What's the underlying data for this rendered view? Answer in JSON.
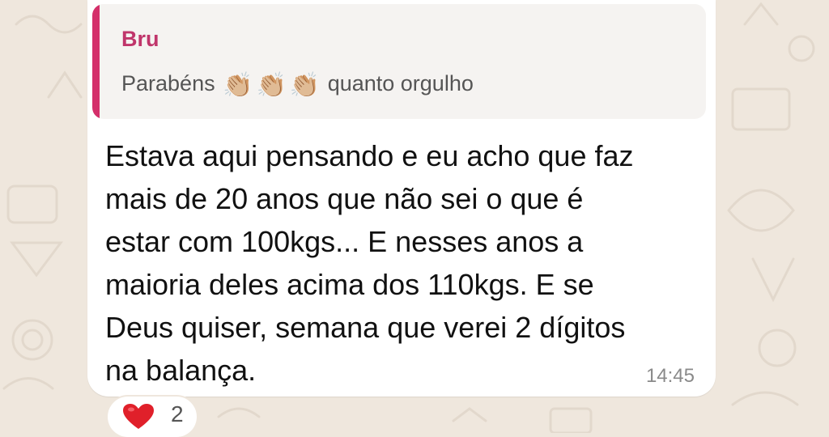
{
  "chat": {
    "reply_quote": {
      "author": "Bru",
      "text_before": "Parabéns",
      "emojis": [
        "👏🏼",
        "👏🏼",
        "👏🏼"
      ],
      "text_after": "quanto orgulho"
    },
    "message": {
      "lines": [
        "Estava aqui pensando e eu acho que faz",
        "mais de 20 anos que não sei o que é",
        "estar com 100kgs... E nesses anos a",
        "maioria deles acima dos 110kgs. E se",
        "Deus quiser, semana que verei 2 dígitos",
        "na balança."
      ],
      "time": "14:45"
    },
    "reaction": {
      "emoji": "❤️",
      "icon": "heart-icon",
      "count": "2"
    }
  },
  "colors": {
    "wallpaper": "#efe7dd",
    "quote_bar": "#d42f6a",
    "author": "#c0356b",
    "heart": "#e0202a"
  }
}
